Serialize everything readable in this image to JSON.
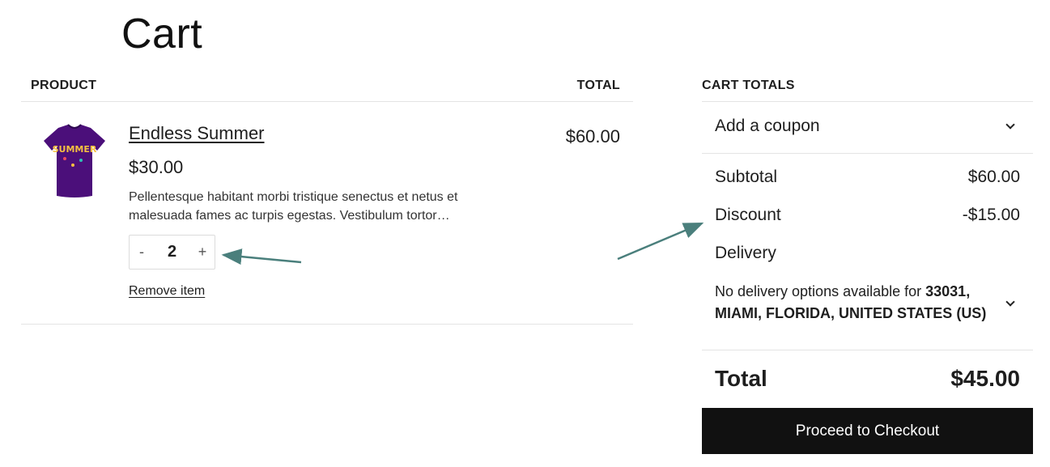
{
  "page": {
    "title": "Cart"
  },
  "cart": {
    "headers": {
      "product": "PRODUCT",
      "total": "TOTAL"
    },
    "item": {
      "name": "Endless Summer",
      "price": "$30.00",
      "description": "Pellentesque habitant morbi tristique senectus et netus et malesuada fames ac turpis egestas. Vestibulum tortor…",
      "quantity": "2",
      "minus_label": "-",
      "plus_label": "+",
      "remove_label": "Remove item",
      "line_total": "$60.00",
      "thumbnail_text": "SUMMER"
    }
  },
  "totals": {
    "title": "CART TOTALS",
    "coupon_label": "Add a coupon",
    "subtotal_label": "Subtotal",
    "subtotal_value": "$60.00",
    "discount_label": "Discount",
    "discount_value": "-$15.00",
    "delivery_label": "Delivery",
    "delivery_note_prefix": "No delivery options available for ",
    "delivery_location": "33031, MIAMI, FLORIDA, UNITED STATES (US)",
    "total_label": "Total",
    "total_value": "$45.00",
    "checkout_label": "Proceed to Checkout"
  },
  "colors": {
    "annotation_arrow": "#4a7f7c",
    "tshirt": "#4b0f7a",
    "button_bg": "#111111"
  }
}
